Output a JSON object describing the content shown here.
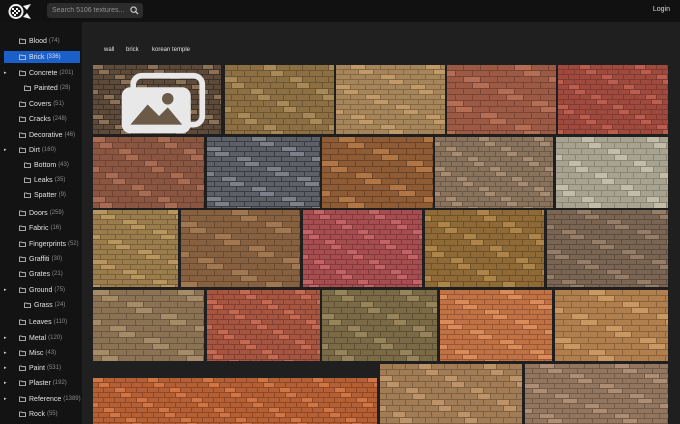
{
  "header": {
    "search_placeholder": "Search 5106 textures...",
    "login_label": "Login",
    "logo_icon": "textures-logo-icon",
    "search_icon": "search-icon"
  },
  "sidebar": {
    "categories": [
      {
        "label": "Blood",
        "count": "(74)",
        "has_arrow": false
      },
      {
        "label": "Brick",
        "count": "(336)",
        "has_arrow": false,
        "active": true
      },
      {
        "label": "Concrete",
        "count": "(201)",
        "has_arrow": true
      },
      {
        "label": "Painted",
        "count": "(28)",
        "has_arrow": false
      },
      {
        "label": "Covers",
        "count": "(51)",
        "has_arrow": false
      },
      {
        "label": "Cracks",
        "count": "(248)",
        "has_arrow": false
      },
      {
        "label": "Decorative",
        "count": "(46)",
        "has_arrow": false
      },
      {
        "label": "Dirt",
        "count": "(160)",
        "has_arrow": true
      },
      {
        "label": "Bottom",
        "count": "(43)",
        "has_arrow": false
      },
      {
        "label": "Leaks",
        "count": "(35)",
        "has_arrow": false
      },
      {
        "label": "Spatter",
        "count": "(9)",
        "has_arrow": false
      },
      {
        "label": "Doors",
        "count": "(259)",
        "has_arrow": false
      },
      {
        "label": "Fabric",
        "count": "(16)",
        "has_arrow": false
      },
      {
        "label": "Fingerprints",
        "count": "(52)",
        "has_arrow": false
      },
      {
        "label": "Graffiti",
        "count": "(30)",
        "has_arrow": false
      },
      {
        "label": "Grates",
        "count": "(21)",
        "has_arrow": false
      },
      {
        "label": "Ground",
        "count": "(75)",
        "has_arrow": true
      },
      {
        "label": "Grass",
        "count": "(24)",
        "has_arrow": false
      },
      {
        "label": "Leaves",
        "count": "(110)",
        "has_arrow": false
      },
      {
        "label": "Metal",
        "count": "(120)",
        "has_arrow": true
      },
      {
        "label": "Misc",
        "count": "(43)",
        "has_arrow": true
      },
      {
        "label": "Paint",
        "count": "(531)",
        "has_arrow": true
      },
      {
        "label": "Plaster",
        "count": "(192)",
        "has_arrow": true
      },
      {
        "label": "Reference",
        "count": "(1389)",
        "has_arrow": true
      },
      {
        "label": "Rock",
        "count": "(55)",
        "has_arrow": false
      }
    ]
  },
  "tags": [
    "wall",
    "brick",
    "korean temple"
  ],
  "colors": {
    "accent": "#1b5fc9",
    "sidebar_bg": "#131313",
    "main_bg": "#1f1f1f"
  },
  "textures": [
    {
      "name": "brick-texture-1",
      "palette": [
        "#5e4a39",
        "#8a7158",
        "#3e3128"
      ]
    },
    {
      "name": "brick-texture-2",
      "palette": [
        "#8c7043",
        "#a88a58",
        "#6b5533"
      ]
    },
    {
      "name": "brick-texture-3",
      "palette": [
        "#a7855c",
        "#c19a6c",
        "#86683f"
      ]
    },
    {
      "name": "brick-texture-4",
      "palette": [
        "#9c5a44",
        "#b46e55",
        "#7a4434"
      ]
    },
    {
      "name": "brick-texture-5",
      "palette": [
        "#a0493d",
        "#bc5e4f",
        "#7f3a31"
      ]
    },
    {
      "name": "brick-texture-6",
      "palette": [
        "#8b5641",
        "#a86c55",
        "#6e4332"
      ]
    },
    {
      "name": "brick-texture-7",
      "palette": [
        "#5d6066",
        "#7d8088",
        "#3a3c40"
      ]
    },
    {
      "name": "brick-texture-8",
      "palette": [
        "#8f5b35",
        "#b07646",
        "#6a4428"
      ]
    },
    {
      "name": "brick-texture-9",
      "palette": [
        "#8a735c",
        "#a68c72",
        "#6b5847"
      ]
    },
    {
      "name": "brick-texture-10",
      "palette": [
        "#a8a291",
        "#c2bca9",
        "#8b8575"
      ]
    },
    {
      "name": "brick-texture-11",
      "palette": [
        "#9b7c4c",
        "#b8965f",
        "#7a5f38"
      ]
    },
    {
      "name": "brick-texture-12",
      "palette": [
        "#86603f",
        "#a27853",
        "#684a30"
      ]
    },
    {
      "name": "brick-texture-13",
      "palette": [
        "#a64d4f",
        "#c26366",
        "#83393c"
      ]
    },
    {
      "name": "brick-texture-14",
      "palette": [
        "#8f6a36",
        "#ad844a",
        "#6f5128"
      ]
    },
    {
      "name": "brick-texture-15",
      "palette": [
        "#7a6552",
        "#957d67",
        "#5e4d3f"
      ]
    },
    {
      "name": "brick-texture-16",
      "palette": [
        "#8a7253",
        "#a68b69",
        "#6b573f"
      ]
    },
    {
      "name": "brick-texture-17",
      "palette": [
        "#a65541",
        "#c46a53",
        "#843f31"
      ]
    },
    {
      "name": "brick-texture-18",
      "palette": [
        "#7a6a45",
        "#97845a",
        "#5d5034"
      ]
    },
    {
      "name": "brick-texture-19",
      "palette": [
        "#c07245",
        "#d98b5a",
        "#9a5532"
      ]
    },
    {
      "name": "brick-texture-20",
      "palette": [
        "#b07f4d",
        "#c99863",
        "#8b6238"
      ]
    },
    {
      "name": "brick-texture-21",
      "palette": [
        "#b55f35",
        "#d07546",
        "#8f4726"
      ]
    },
    {
      "name": "brick-texture-22",
      "palette": [
        "#a27c55",
        "#bd946a",
        "#7f5f3f"
      ]
    },
    {
      "name": "brick-texture-23",
      "palette": [
        "#93765f",
        "#ad8e75",
        "#735b48"
      ]
    }
  ]
}
